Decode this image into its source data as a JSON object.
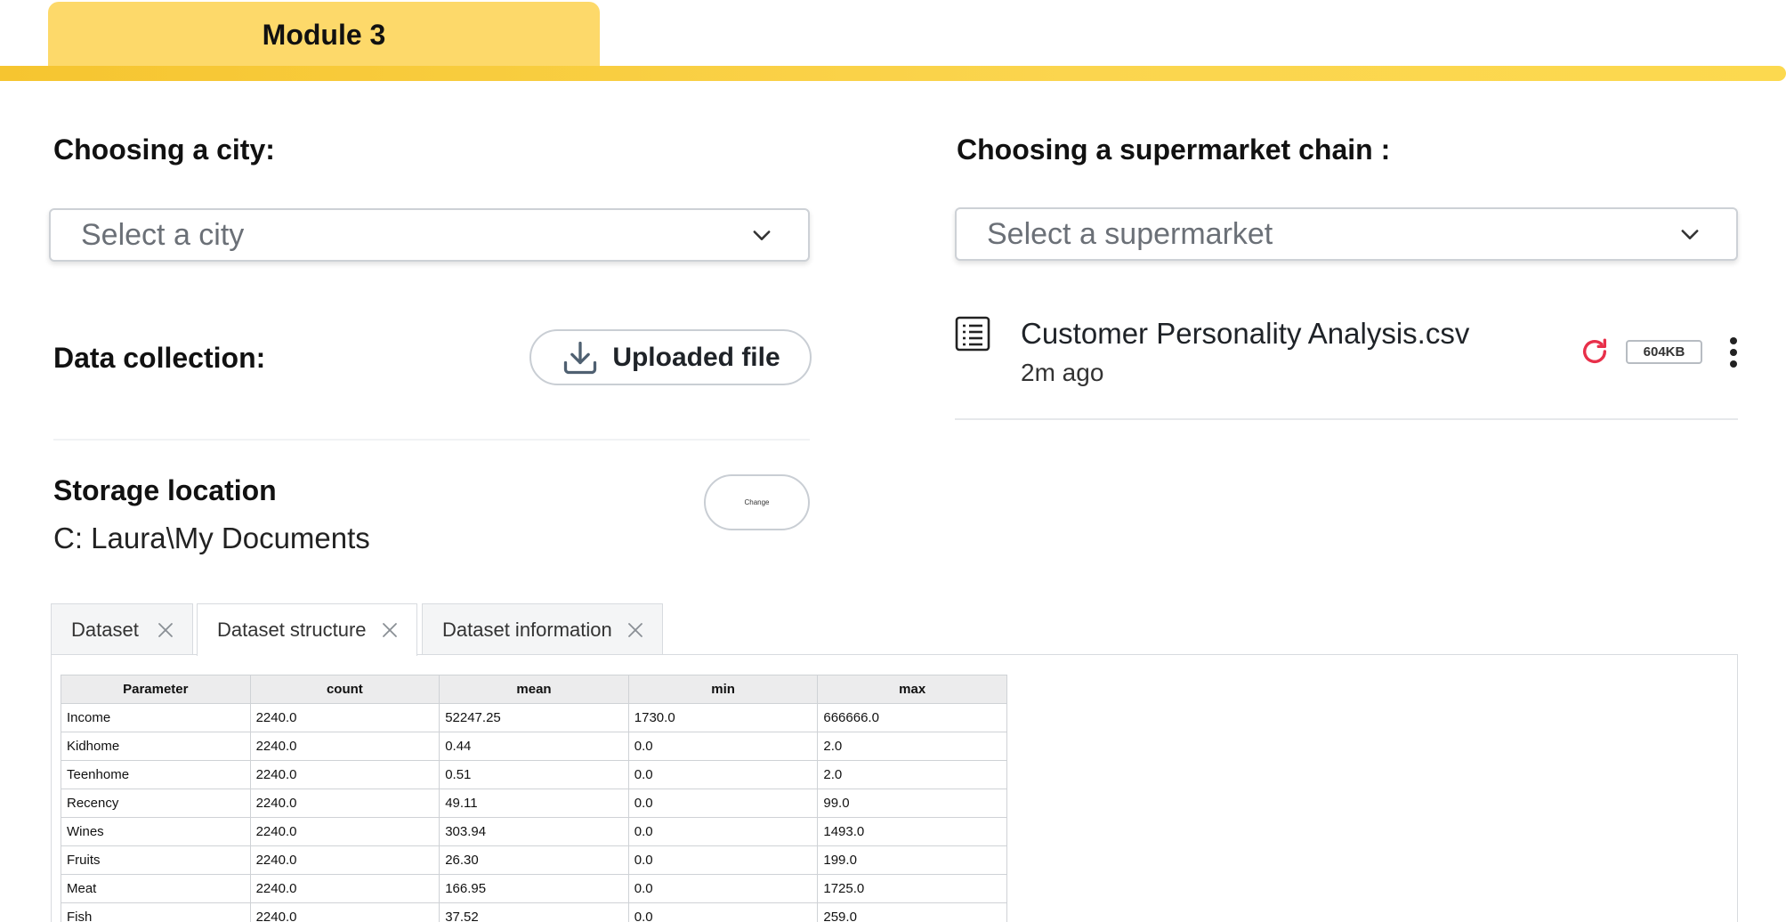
{
  "module": {
    "title": "Module 3"
  },
  "city": {
    "heading": "Choosing a city:",
    "placeholder": "Select a city"
  },
  "supermarket": {
    "heading": "Choosing a supermarket chain :",
    "placeholder": "Select a supermarket"
  },
  "data_collection": {
    "heading": "Data collection:",
    "upload_label": "Uploaded file"
  },
  "storage": {
    "heading": "Storage location",
    "path": "C: Laura\\My Documents",
    "change_label": "Change"
  },
  "file": {
    "name": "Customer Personality Analysis.csv",
    "time": "2m ago",
    "size": "604KB",
    "icon": "document-list-icon",
    "refresh_color": "#e8304a"
  },
  "tabs": [
    {
      "label": "Dataset"
    },
    {
      "label": "Dataset structure",
      "active": true
    },
    {
      "label": "Dataset information"
    }
  ],
  "table": {
    "columns": [
      "Parameter",
      "count",
      "mean",
      "min",
      "max"
    ],
    "rows": [
      [
        "Income",
        "2240.0",
        "52247.25",
        "1730.0",
        "666666.0"
      ],
      [
        "Kidhome",
        "2240.0",
        "0.44",
        "0.0",
        "2.0"
      ],
      [
        "Teenhome",
        "2240.0",
        "0.51",
        "0.0",
        "2.0"
      ],
      [
        "Recency",
        "2240.0",
        "49.11",
        "0.0",
        "99.0"
      ],
      [
        "Wines",
        "2240.0",
        "303.94",
        "0.0",
        "1493.0"
      ],
      [
        "Fruits",
        "2240.0",
        "26.30",
        "0.0",
        "199.0"
      ],
      [
        "Meat",
        "2240.0",
        "166.95",
        "0.0",
        "1725.0"
      ],
      [
        "Fish",
        "2240.0",
        "37.52",
        "0.0",
        "259.0"
      ]
    ]
  },
  "colors": {
    "accent": "#fdd96a",
    "bar": "#f6c530"
  }
}
